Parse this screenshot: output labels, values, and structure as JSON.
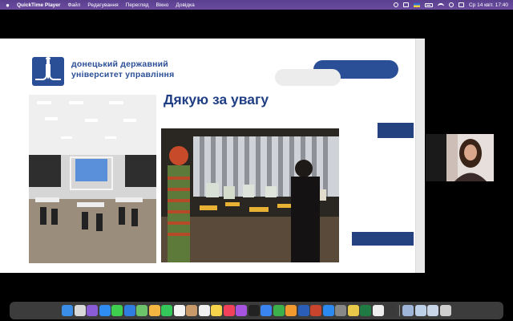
{
  "menubar": {
    "app_name": "QuickTime Player",
    "items": [
      "Файл",
      "Редагування",
      "Перегляд",
      "Вікно",
      "Довідка"
    ],
    "clock": "Ср 14 квіт. 17:40"
  },
  "slide": {
    "university_line1": "донецький державний",
    "university_line2": "університет управління",
    "heading": "Дякую за увагу"
  },
  "dock": {
    "icons": [
      {
        "name": "finder-icon",
        "color": "#3b8ee8"
      },
      {
        "name": "launchpad-icon",
        "color": "#d9d9d9"
      },
      {
        "name": "siri-icon",
        "color": "#8a5cd8"
      },
      {
        "name": "safari-icon",
        "color": "#2f8cf0"
      },
      {
        "name": "messages-icon",
        "color": "#3ecf4e"
      },
      {
        "name": "mail-icon",
        "color": "#2f7de0"
      },
      {
        "name": "maps-icon",
        "color": "#6cc36a"
      },
      {
        "name": "photos-icon",
        "color": "#f5b642"
      },
      {
        "name": "facetime-icon",
        "color": "#34c759"
      },
      {
        "name": "calendar-icon",
        "color": "#f4f4f4"
      },
      {
        "name": "contacts-icon",
        "color": "#c89a6a"
      },
      {
        "name": "reminders-icon",
        "color": "#f0f0f0"
      },
      {
        "name": "notes-icon",
        "color": "#f5d34a"
      },
      {
        "name": "music-icon",
        "color": "#f2415a"
      },
      {
        "name": "podcasts-icon",
        "color": "#a754e0"
      },
      {
        "name": "tv-icon",
        "color": "#222222"
      },
      {
        "name": "keynote-icon",
        "color": "#3a84f0"
      },
      {
        "name": "numbers-icon",
        "color": "#3cb04a"
      },
      {
        "name": "pages-icon",
        "color": "#f29a2e"
      },
      {
        "name": "word-icon",
        "color": "#2b5eb8"
      },
      {
        "name": "powerpoint-icon",
        "color": "#c8442c"
      },
      {
        "name": "appstore-icon",
        "color": "#2a8af0"
      },
      {
        "name": "preferences-icon",
        "color": "#888888"
      },
      {
        "name": "chrome-icon",
        "color": "#e8c94a"
      },
      {
        "name": "excel-icon",
        "color": "#1f7a44"
      },
      {
        "name": "textedit-icon",
        "color": "#eeeeee"
      },
      {
        "name": "quicktime-icon",
        "color": "#3a3a3a"
      },
      {
        "name": "preview-icon",
        "color": "#9fb6d8"
      },
      {
        "name": "folder-icon",
        "color": "#bcd0e8"
      },
      {
        "name": "downloads-icon",
        "color": "#c8d6e8"
      },
      {
        "name": "trash-icon",
        "color": "#cfcfcf"
      }
    ]
  }
}
